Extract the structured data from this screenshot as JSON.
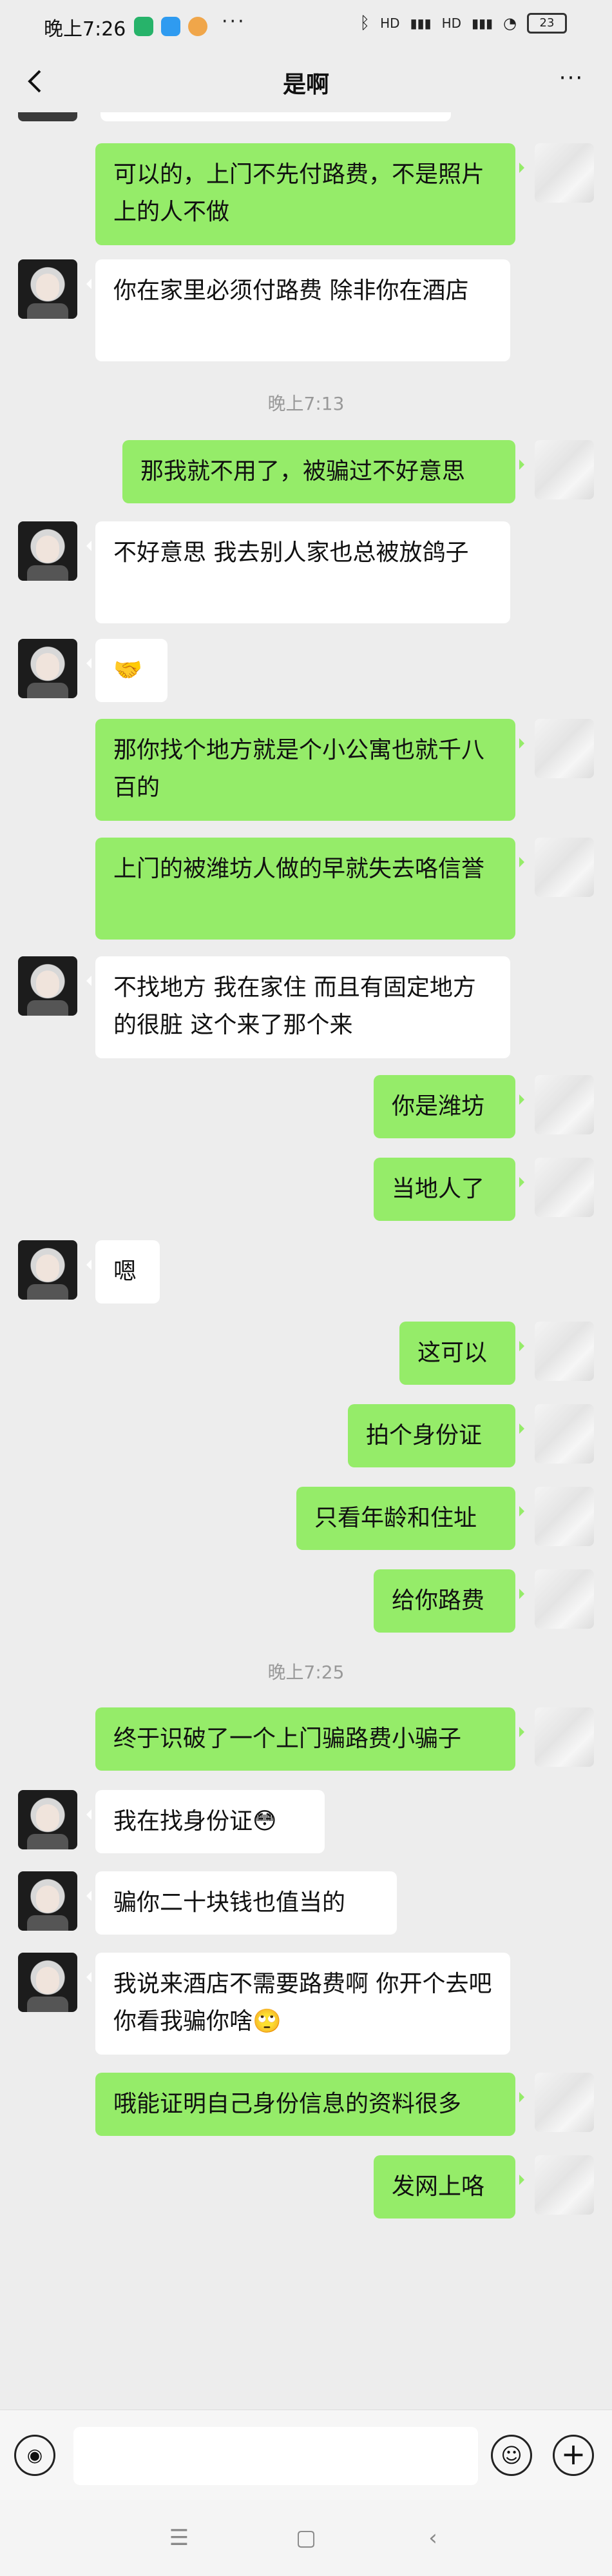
{
  "status_bar": {
    "time": "晚上7:26",
    "dots": "···",
    "signal_1": "HD",
    "signal_2": "HD",
    "battery": "23"
  },
  "nav": {
    "back_icon": "chevron-left-icon",
    "title": "是啊",
    "more_icon": "more-dots-icon",
    "more_glyph": "···"
  },
  "chat": {
    "messages": [
      {
        "side": "out",
        "text": "可以的，上门不先付路费，不是照片上的人不做"
      },
      {
        "side": "in",
        "text": "你在家里必须付路费 除非你在酒店"
      },
      {
        "type": "time",
        "text": "晚上7:13"
      },
      {
        "side": "out",
        "text": "那我就不用了，被骗过不好意思"
      },
      {
        "side": "in",
        "text": "不好意思 我去别人家也总被放鸽子"
      },
      {
        "side": "in",
        "text": "🤝"
      },
      {
        "side": "out",
        "text": "那你找个地方就是个小公寓也就千八百的"
      },
      {
        "side": "out",
        "text": "上门的被潍坊人做的早就失去咯信誉"
      },
      {
        "side": "in",
        "text": "不找地方 我在家住 而且有固定地方的很脏 这个来了那个来"
      },
      {
        "side": "out",
        "text": "你是潍坊"
      },
      {
        "side": "out",
        "text": "当地人了"
      },
      {
        "side": "in",
        "text": "嗯"
      },
      {
        "side": "out",
        "text": "这可以"
      },
      {
        "side": "out",
        "text": "拍个身份证"
      },
      {
        "side": "out",
        "text": "只看年龄和住址"
      },
      {
        "side": "out",
        "text": "给你路费"
      },
      {
        "type": "time",
        "text": "晚上7:25"
      },
      {
        "side": "out",
        "text": "终于识破了一个上门骗路费小骗子"
      },
      {
        "side": "in",
        "text": "我在找身份证😳"
      },
      {
        "side": "in",
        "text": "骗你二十块钱也值当的"
      },
      {
        "side": "in",
        "text": "我说来酒店不需要路费啊 你开个去吧 你看我骗你啥🙄"
      },
      {
        "side": "out",
        "text": "哦能证明自己身份信息的资料很多"
      },
      {
        "side": "out",
        "text": "发网上咯"
      }
    ]
  },
  "input_bar": {
    "voice_icon": "voice-icon",
    "voice_glyph": "◉",
    "emoji_icon": "emoji-icon",
    "emoji_glyph": "☺",
    "plus_icon": "plus-icon",
    "plus_glyph": "+"
  },
  "system_nav": {
    "menu_glyph": "☰",
    "home_glyph": "▢",
    "back_glyph": "‹"
  },
  "colors": {
    "outgoing_bubble": "#95ec69",
    "incoming_bubble": "#ffffff",
    "background": "#ededed",
    "timestamp_text": "#999999"
  }
}
